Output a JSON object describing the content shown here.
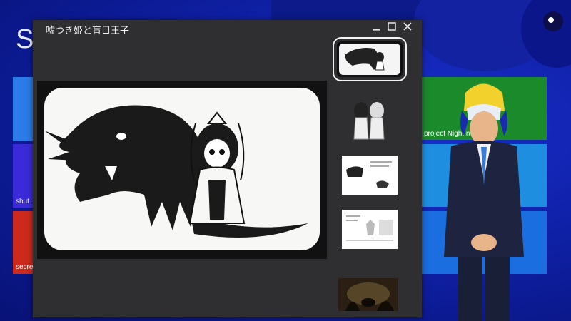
{
  "background": {
    "title_fragment": "S",
    "tiles": [
      {
        "label": "",
        "color": "#2b7be8"
      },
      {
        "label": "shut",
        "color": "#3a2ad8"
      },
      {
        "label": "secre",
        "color": "#cc2a1c"
      },
      {
        "label": "",
        "color": "#1a8a2a"
      },
      {
        "label": "project Night n",
        "color": "#1f9a2a"
      },
      {
        "label": "",
        "color": "#1e8fe0"
      },
      {
        "label": "",
        "color": "#1a6ee0"
      }
    ]
  },
  "window": {
    "title": "嘘つき姫と盲目王子",
    "controls": {
      "minimize": "minimize-icon",
      "maximize": "maximize-icon",
      "close": "close-icon"
    }
  },
  "gallery": {
    "selected_index": 0,
    "thumbnails": [
      {
        "kind": "illustration"
      },
      {
        "kind": "characters"
      },
      {
        "kind": "document"
      },
      {
        "kind": "document"
      },
      {
        "kind": "dark-scene"
      }
    ]
  },
  "colors": {
    "window_bg": "#2f2f31",
    "accent_bg": "#0f21a8"
  }
}
